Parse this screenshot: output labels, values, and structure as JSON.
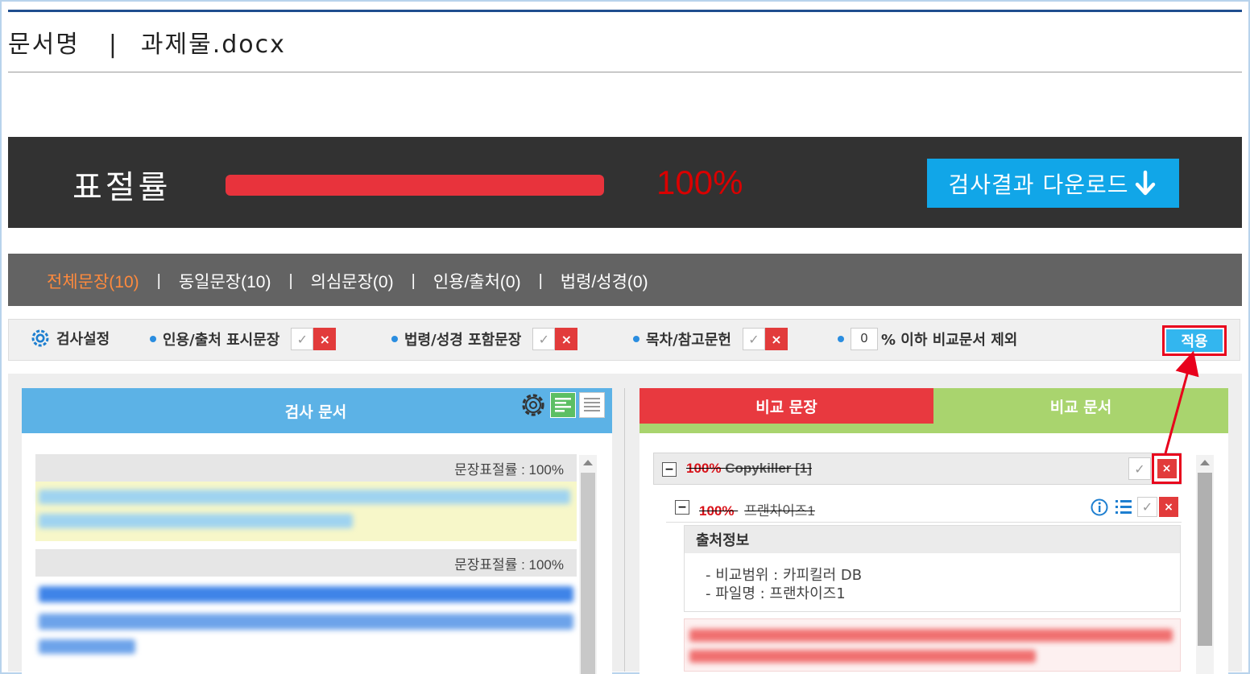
{
  "document": {
    "label": "문서명",
    "separator": "|",
    "filename": "과제물.docx"
  },
  "summary": {
    "plagiarism_label": "표절률",
    "plagiarism_percent_text": "100%",
    "plagiarism_fraction": 1.0,
    "download_label": "검사결과 다운로드",
    "colors": {
      "bar": "#e8333c",
      "percent": "#d90000",
      "download": "#11a6e8"
    }
  },
  "tabs": [
    {
      "label": "전체문장(10)",
      "active": true
    },
    {
      "label": "동일문장(10)"
    },
    {
      "label": "의심문장(0)"
    },
    {
      "label": "인용/출처(0)"
    },
    {
      "label": "법령/성경(0)"
    }
  ],
  "tab_separator": "|",
  "settings": {
    "title": "검사설정",
    "options": [
      {
        "label": "인용/출처 표시문장"
      },
      {
        "label": "법령/성경 포함문장"
      },
      {
        "label": "목차/참고문헌"
      }
    ],
    "threshold_value": "0",
    "threshold_label": "% 이하 비교문서 제외",
    "apply_label": "적용",
    "check_glyph": "✓",
    "x_glyph": "×"
  },
  "left_panel": {
    "title": "검사 문서",
    "sentences": [
      {
        "rate_label": "문장표절률 : 100%"
      },
      {
        "rate_label": "문장표절률 : 100%"
      }
    ]
  },
  "right_panel": {
    "tab_compare_sentence": "비교 문장",
    "tab_compare_document": "비교 문서",
    "groups": [
      {
        "percent": "100%",
        "source": "Copykiller [1]",
        "items": [
          {
            "percent": "100%",
            "name": "프랜차이즈1",
            "info_title": "출처정보",
            "info_lines": [
              "- 비교범위 : 카피킬러 DB",
              "- 파일명 : 프랜차이즈1"
            ]
          }
        ]
      }
    ]
  }
}
